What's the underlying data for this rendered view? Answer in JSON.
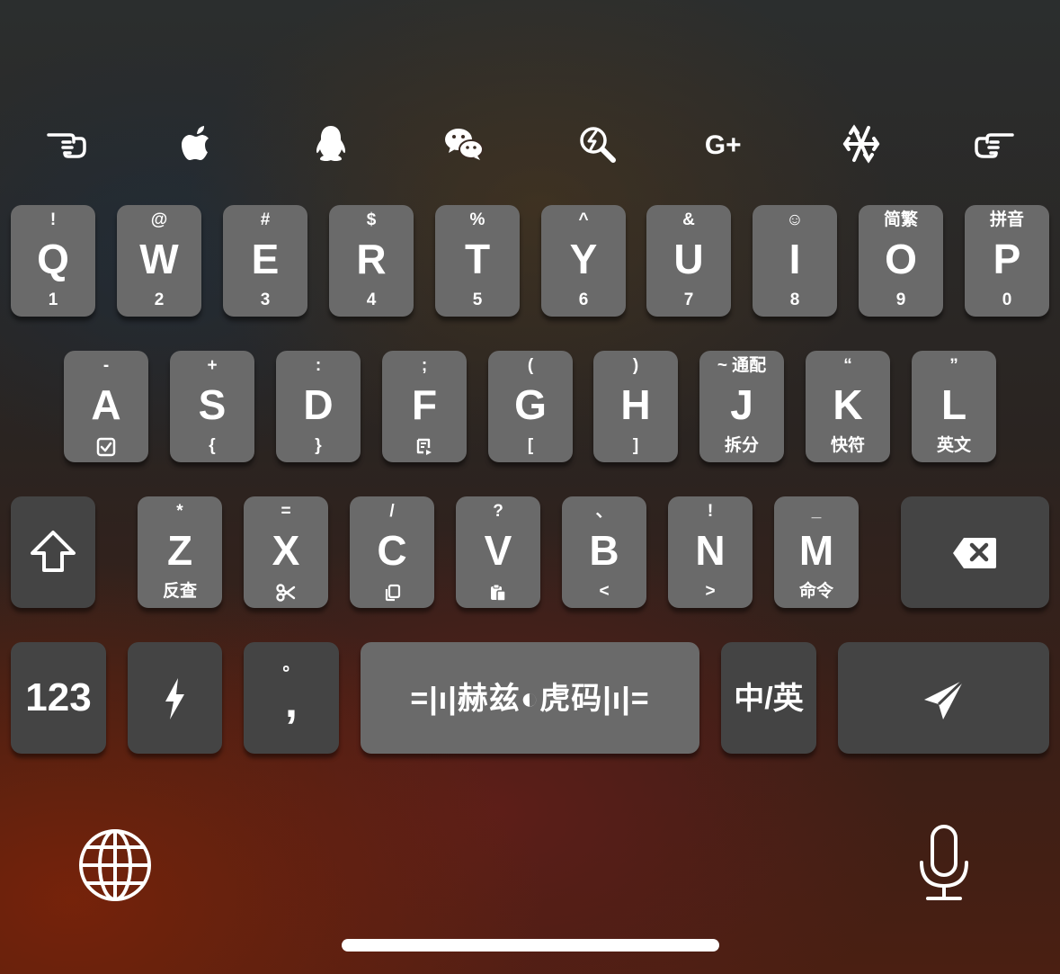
{
  "toolbar": {
    "icons": [
      "pointing-hand-left-icon",
      "apple-icon",
      "qq-penguin-icon",
      "wechat-icon",
      "search-bolt-icon",
      "google-plus-icon",
      "snowflake-icon",
      "pointing-hand-right-icon"
    ],
    "google_plus_label": "G+"
  },
  "row1": [
    {
      "main": "Q",
      "top": "!",
      "bot": "1"
    },
    {
      "main": "W",
      "top": "@",
      "bot": "2"
    },
    {
      "main": "E",
      "top": "#",
      "bot": "3"
    },
    {
      "main": "R",
      "top": "$",
      "bot": "4"
    },
    {
      "main": "T",
      "top": "%",
      "bot": "5"
    },
    {
      "main": "Y",
      "top": "^",
      "bot": "6"
    },
    {
      "main": "U",
      "top": "&",
      "bot": "7"
    },
    {
      "main": "I",
      "top": "☺",
      "bot": "8"
    },
    {
      "main": "O",
      "top": "简繁",
      "bot": "9"
    },
    {
      "main": "P",
      "top": "拼音",
      "bot": "0"
    }
  ],
  "row2": [
    {
      "main": "A",
      "top": "-",
      "bot": ""
    },
    {
      "main": "S",
      "top": "+",
      "bot": "{"
    },
    {
      "main": "D",
      "top": ":",
      "bot": "}"
    },
    {
      "main": "F",
      "top": ";",
      "bot": ""
    },
    {
      "main": "G",
      "top": "(",
      "bot": "["
    },
    {
      "main": "H",
      "top": ")",
      "bot": "]"
    },
    {
      "main": "J",
      "top": "~ 通配",
      "bot": "拆分"
    },
    {
      "main": "K",
      "top": "“",
      "bot": "快符"
    },
    {
      "main": "L",
      "top": "”",
      "bot": "英文"
    }
  ],
  "row3": [
    {
      "main": "Z",
      "top": "*",
      "bot": "反查"
    },
    {
      "main": "X",
      "top": "=",
      "bot": ""
    },
    {
      "main": "C",
      "top": "/",
      "bot": ""
    },
    {
      "main": "V",
      "top": "?",
      "bot": ""
    },
    {
      "main": "B",
      "top": "、",
      "bot": "<"
    },
    {
      "main": "N",
      "top": "!",
      "bot": ">"
    },
    {
      "main": "M",
      "top": "_",
      "bot": "命令"
    }
  ],
  "row4": {
    "numbers_label": "123",
    "comma_top": "。",
    "comma_main": ",",
    "space_label": "=|ı|赫兹◐虎码|ı|=",
    "lang_label": "中/英"
  },
  "bottom": {
    "globe_icon": "globe-icon",
    "mic_icon": "microphone-icon"
  }
}
